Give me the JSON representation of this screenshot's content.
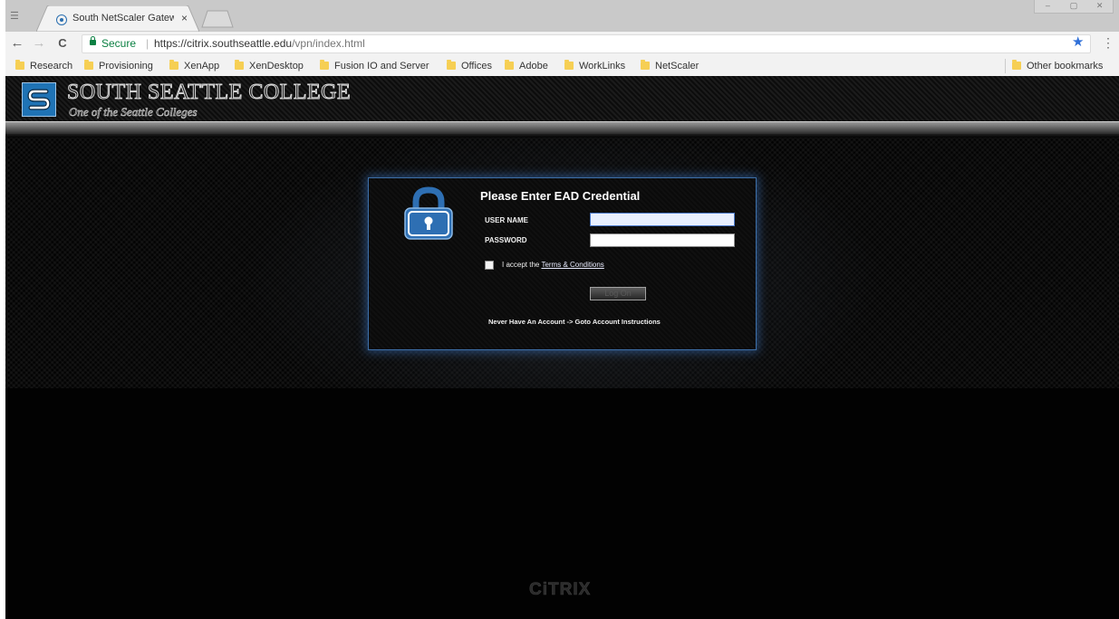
{
  "browser": {
    "tab": {
      "title": "South NetScaler Gatewa",
      "close": "×"
    },
    "window_controls": [
      "–",
      "▢",
      "✕"
    ],
    "nav": {
      "back": "←",
      "forward": "→",
      "reload": "C"
    },
    "address": {
      "secure_label": "Secure",
      "separator": "|",
      "url_host": "https://citrix.southseattle.edu",
      "url_path": "/vpn/index.html"
    },
    "menu": "⋮",
    "star": "★",
    "bookmarks": [
      "Research",
      "Provisioning",
      "XenApp",
      "XenDesktop",
      "Fusion IO and Server",
      "Offices",
      "Adobe",
      "WorkLinks",
      "NetScaler"
    ],
    "other_bookmarks": "Other bookmarks"
  },
  "header": {
    "college_name": "SOUTH SEATTLE COLLEGE",
    "tagline": "One of the Seattle Colleges"
  },
  "login": {
    "title": "Please Enter EAD Credential",
    "username_label": "USER NAME",
    "username_value": "",
    "password_label": "PASSWORD",
    "password_value": "",
    "accept_prefix": "I accept the ",
    "terms_link": "Terms & Conditions",
    "logon_button": "Log On",
    "account_text": "Never Have An Account -> Goto Account Instructions"
  },
  "footer": {
    "brand": "CiTRIX"
  },
  "colors": {
    "page_bg": "#030303",
    "panel_glow": "#3d6fa8",
    "logo_blue": "#1f73b5",
    "secure_green": "#0b8043",
    "star_blue": "#2f6fd8"
  }
}
